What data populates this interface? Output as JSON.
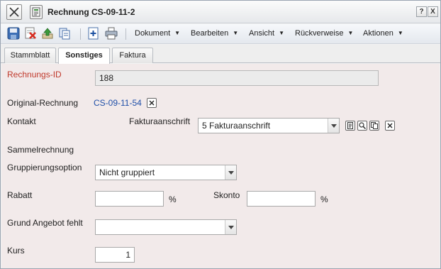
{
  "window": {
    "title": "Rechnung CS-09-11-2",
    "help_label": "?",
    "close_label": "X"
  },
  "toolbar": {
    "icons": [
      "save-icon",
      "delete-icon",
      "upload-icon",
      "copy-icon",
      "new-document-icon",
      "print-icon"
    ],
    "menus": {
      "dokument": "Dokument",
      "bearbeiten": "Bearbeiten",
      "ansicht": "Ansicht",
      "rueckverweise": "Rückverweise",
      "aktionen": "Aktionen"
    },
    "menu_arrow": "▼"
  },
  "tabs": {
    "stammblatt": "Stammblatt",
    "sonstiges": "Sonstiges",
    "faktura": "Faktura",
    "active": "Sonstiges"
  },
  "form": {
    "rechnungs_id": {
      "label": "Rechnungs-ID",
      "value": "188"
    },
    "original_rechnung": {
      "label": "Original-Rechnung",
      "value": "CS-09-11-54"
    },
    "kontakt": {
      "label": "Kontakt"
    },
    "fakturaanschrift": {
      "label": "Fakturaanschrift",
      "value": "5 Fakturaanschrift"
    },
    "sammelrechnung": {
      "label": "Sammelrechnung"
    },
    "gruppierungsoption": {
      "label": "Gruppierungsoption",
      "value": "Nicht gruppiert"
    },
    "rabatt": {
      "label": "Rabatt",
      "value": "",
      "unit": "%"
    },
    "skonto": {
      "label": "Skonto",
      "value": "",
      "unit": "%"
    },
    "grund_angebot_fehlt": {
      "label": "Grund Angebot fehlt",
      "value": ""
    },
    "kurs": {
      "label": "Kurs",
      "value": "1"
    }
  },
  "colors": {
    "required_label": "#c0392b",
    "link": "#1f4fa8",
    "content_bg": "#f2eaea"
  }
}
